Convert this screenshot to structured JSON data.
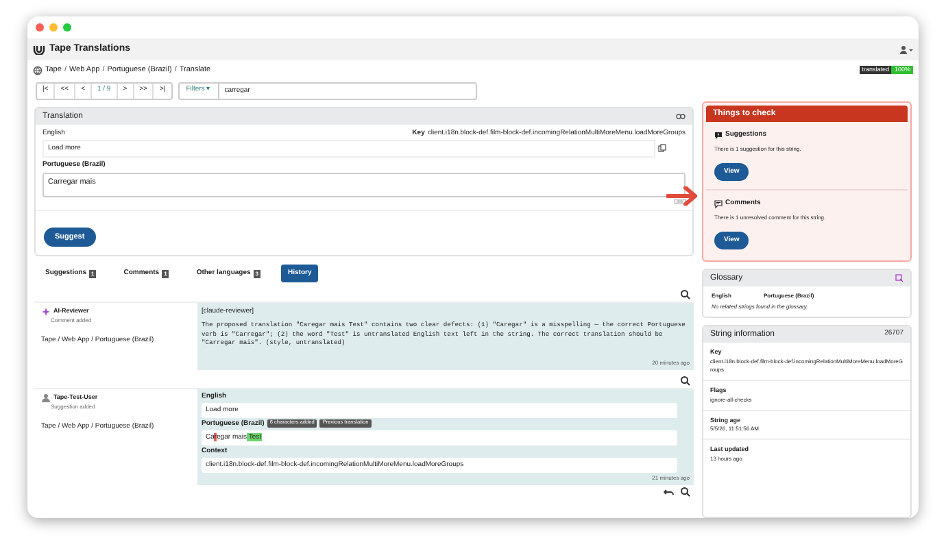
{
  "app": {
    "title": "Tape Translations"
  },
  "breadcrumb": {
    "separator": "/",
    "items": [
      "Tape",
      "Web App",
      "Portuguese (Brazil)",
      "Translate"
    ]
  },
  "status_badge": {
    "label": "translated",
    "value": "100%"
  },
  "nav": {
    "buttons": [
      "|<",
      "<<",
      "<",
      "1 / 9",
      ">",
      ">>",
      ">|"
    ],
    "filters": "Filters ▾",
    "search_value": "carregar"
  },
  "translation": {
    "title": "Translation",
    "source_label": "English",
    "key_label": "Key",
    "key": "client.i18n.block-def.film-block-def.incomingRelationMultiMoreMenu.loadMoreGroups",
    "source": "Load more",
    "target_label": "Portuguese (Brazil)",
    "target": "Carregar mais",
    "suggest": "Suggest"
  },
  "tabs": [
    {
      "label": "Suggestions",
      "count": "1",
      "selected": false
    },
    {
      "label": "Comments",
      "count": "1",
      "selected": false
    },
    {
      "label": "Other languages",
      "count": "3",
      "selected": false
    },
    {
      "label": "History",
      "selected": true
    }
  ],
  "history": [
    {
      "kind": "comment",
      "user": "AI-Reviewer",
      "action": "Comment added",
      "path": "Tape / Web App / Portuguese (Brazil)",
      "tag": "[claude-reviewer]",
      "text": "The proposed translation \"Caregar mais Test\" contains two clear defects: (1) \"Caregar\" is a misspelling — the correct Portuguese verb is \"Carregar\"; (2) the word \"Test\" is untranslated English text left in the string. The correct translation should be \"Carregar mais\". (style, untranslated)",
      "time": "20 minutes ago"
    },
    {
      "kind": "suggestion",
      "user": "Tape-Test-User",
      "action": "Suggestion added",
      "path": "Tape / Web App / Portuguese (Brazil)",
      "english_label": "English",
      "english": "Load more",
      "target_label": "Portuguese (Brazil)",
      "badges": [
        "6 characters added",
        "Previous translation"
      ],
      "diff": [
        {
          "text": "Ca",
          "kind": "same"
        },
        {
          "text": "r",
          "kind": "removed"
        },
        {
          "text": "egar mais",
          "kind": "same"
        },
        {
          "text": " Test",
          "kind": "added"
        }
      ],
      "context_label": "Context",
      "context": "client.i18n.block-def.film-block-def.incomingRelationMultiMoreMenu.loadMoreGroups",
      "time": "21 minutes ago"
    }
  ],
  "checks": {
    "title": "Things to check",
    "items": [
      {
        "kind": "suggestions",
        "title": "Suggestions",
        "text": "There is 1 suggestion for this string.",
        "button": "View"
      },
      {
        "kind": "comments",
        "title": "Comments",
        "text": "There is 1 unresolved comment for this string.",
        "button": "View"
      }
    ]
  },
  "glossary": {
    "title": "Glossary",
    "columns": [
      "English",
      "Portuguese (Brazil)"
    ],
    "empty": "No related strings found in the glossary."
  },
  "string_info": {
    "title": "String information",
    "id": "26707",
    "fields": [
      {
        "label": "Key",
        "value": "client.i18n.block-def.film-block-def.incomingRelationMultiMoreMenu.loadMoreGroups"
      },
      {
        "label": "Flags",
        "value": "ignore-all-checks"
      },
      {
        "label": "String age",
        "value": "5/5/26, 11:51:56 AM"
      },
      {
        "label": "Last updated",
        "value": "13 hours ago"
      }
    ]
  }
}
